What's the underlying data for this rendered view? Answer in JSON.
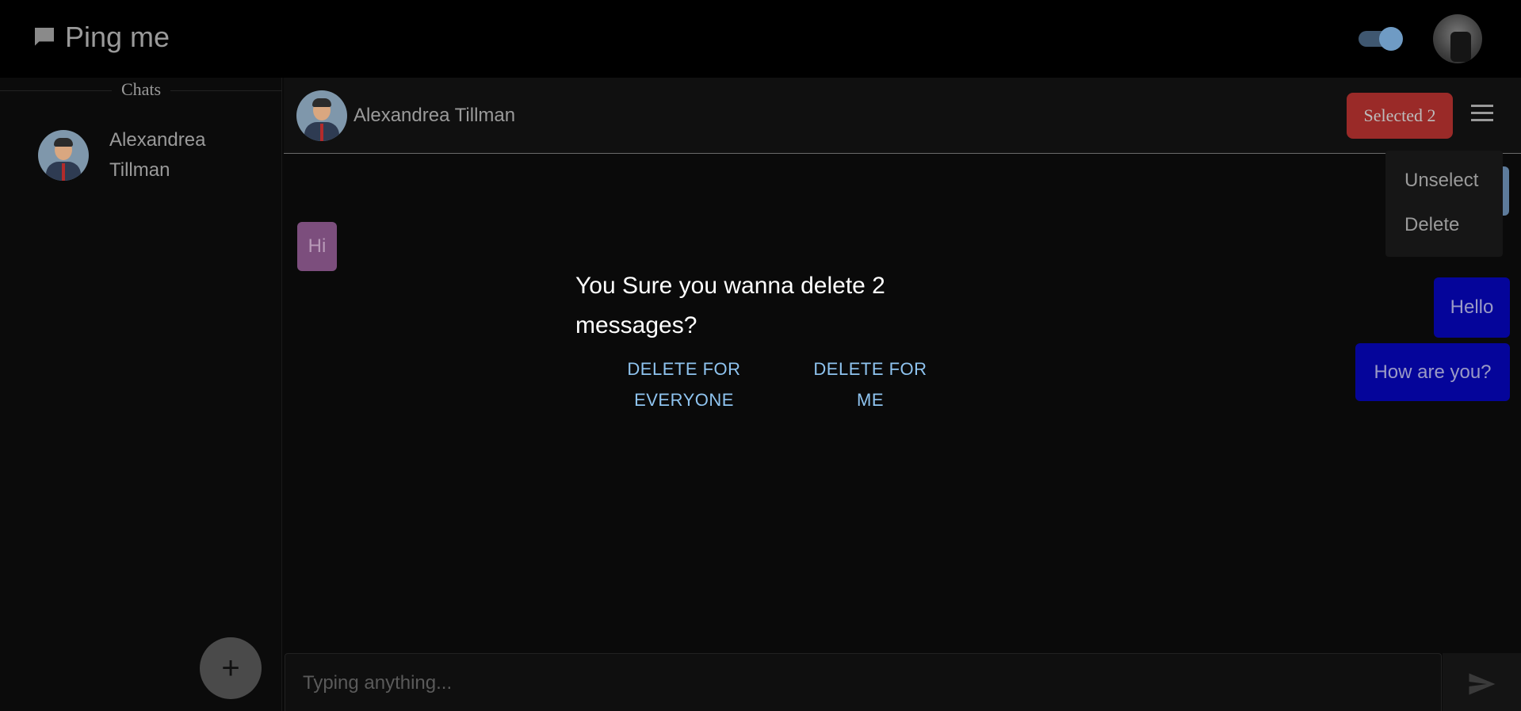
{
  "app": {
    "title": "Ping me"
  },
  "sidebar": {
    "section_label": "Chats",
    "chats": [
      {
        "name_line1": "Alexandrea",
        "name_line2": "Tillman"
      }
    ],
    "fab_label": "+"
  },
  "chat": {
    "contact_name": "Alexandrea Tillman",
    "selected_label": "Selected 2",
    "menu": {
      "unselect": "Unselect",
      "delete": "Delete"
    },
    "messages": [
      {
        "from": "them",
        "text": "Hi"
      },
      {
        "from": "me",
        "text": "Hello"
      },
      {
        "from": "me",
        "text": "How are you?"
      }
    ]
  },
  "dialog": {
    "title": "You Sure you wanna delete 2 messages?",
    "delete_everyone_line1": "DELETE FOR",
    "delete_everyone_line2": "EVERYONE",
    "delete_me_line1": "DELETE FOR",
    "delete_me_line2": "ME"
  },
  "composer": {
    "placeholder": "Typing anything..."
  },
  "colors": {
    "accent_selected": "#9a2a28",
    "my_bubble": "#05059a",
    "their_bubble": "#7c4e7d",
    "dialog_action": "#8fc4f0"
  },
  "icons": [
    "chat-bubble-icon",
    "theme-toggle",
    "menu-icon",
    "send-icon",
    "plus-icon"
  ]
}
